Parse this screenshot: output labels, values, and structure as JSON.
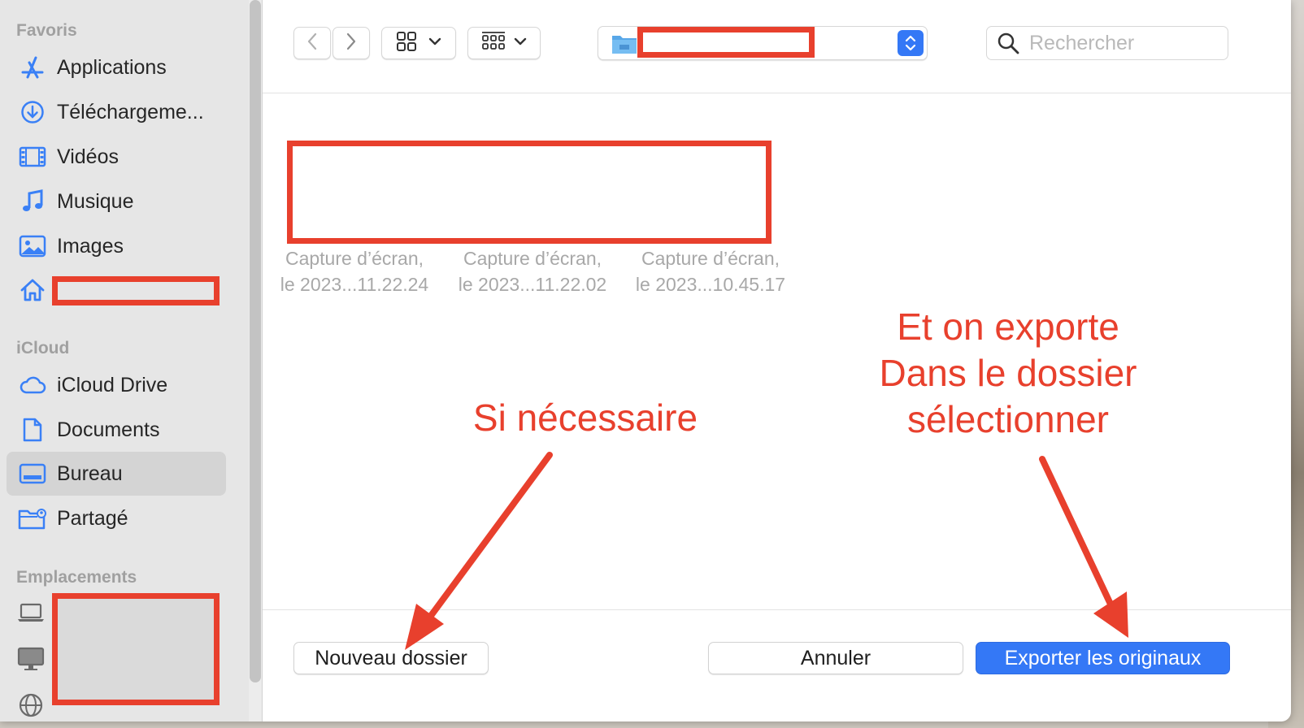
{
  "sidebar": {
    "favorites_header": "Favoris",
    "favorites": [
      {
        "label": "Applications",
        "icon": "applications-icon"
      },
      {
        "label": "Téléchargeme...",
        "icon": "download-icon"
      },
      {
        "label": "Vidéos",
        "icon": "film-icon"
      },
      {
        "label": "Musique",
        "icon": "music-icon"
      },
      {
        "label": "Images",
        "icon": "photo-icon"
      },
      {
        "label": "",
        "icon": "home-icon"
      }
    ],
    "icloud_header": "iCloud",
    "icloud": [
      {
        "label": "iCloud Drive",
        "icon": "cloud-icon"
      },
      {
        "label": "Documents",
        "icon": "document-icon"
      },
      {
        "label": "Bureau",
        "icon": "desktop-icon",
        "selected": true
      },
      {
        "label": "Partagé",
        "icon": "shared-folder-icon"
      }
    ],
    "locations_header": "Emplacements"
  },
  "toolbar": {
    "search_placeholder": "Rechercher"
  },
  "files": [
    {
      "line1": "Capture d’écran,",
      "line2": "le 2023...11.22.24"
    },
    {
      "line1": "Capture d’écran,",
      "line2": "le 2023...11.22.02"
    },
    {
      "line1": "Capture d’écran,",
      "line2": "le 2023...10.45.17"
    }
  ],
  "buttons": {
    "new_folder": "Nouveau dossier",
    "cancel": "Annuler",
    "export": "Exporter les originaux"
  },
  "annotations": {
    "left": "Si nécessaire",
    "right_line1": "Et on exporte",
    "right_line2": "Dans le dossier",
    "right_line3": "sélectionner"
  },
  "colors": {
    "accent": "#3478f6",
    "annotation": "#e8402d"
  }
}
